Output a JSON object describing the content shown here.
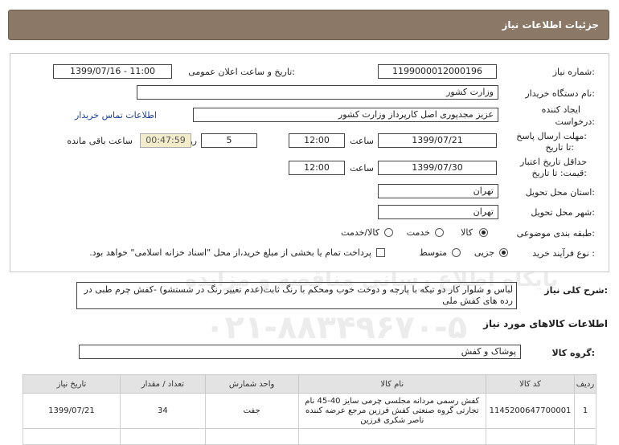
{
  "header": {
    "title": "جزئیات اطلاعات نیاز"
  },
  "form": {
    "need_number_label": "شماره نیاز:",
    "need_number": "1199000012000196",
    "announce_label": "تاریخ و ساعت اعلان عمومی:",
    "announce_value": "1399/07/16 - 11:00",
    "buyer_label": "نام دستگاه خریدار:",
    "buyer_value": "وزارت کشور",
    "creator_label_1": "ایجاد کننده",
    "creator_label_2": "درخواست:",
    "creator_value": "عزیز مجدپوری اصل کارپرداز وزارت کشور",
    "contact_link": "اطلاعات تماس خریدار",
    "deadline_label_1": "مهلت ارسال پاسخ:",
    "deadline_label_2": "تا تاریخ:",
    "deadline_date": "1399/07/21",
    "time_label": "ساعت",
    "deadline_time": "12:00",
    "days_value": "5",
    "days_label": "روز و",
    "remaining_time": "00:47:59",
    "remaining_label": "ساعت باقی مانده",
    "validity_label_1": "حداقل تاریخ اعتبار",
    "validity_label_2": "قیمت: تا تاریخ:",
    "validity_date": "1399/07/30",
    "validity_time": "12:00",
    "province_label": "استان محل تحویل:",
    "province_value": "تهران",
    "city_label": "شهر محل تحویل:",
    "city_value": "تهران",
    "category_label": "طبقه بندی موضوعی:",
    "category_options": [
      "کالا",
      "خدمت",
      "کالا/خدمت"
    ],
    "category_selected": "کالا",
    "process_label": "نوع فرآیند خرید :",
    "process_options": [
      "جزیی",
      "متوسط"
    ],
    "process_selected": "جزیی",
    "payment_note": "پرداخت تمام یا بخشی از مبلغ خرید،از محل \"اسناد خزانه اسلامی\" خواهد بود."
  },
  "description": {
    "label": "شرح کلی نیاز:",
    "text": "لباس و شلوار کار دو تیکه با پارچه  و دوخت خوب ومحکم با رنگ ثابت(عدم تغییر رنگ در شستشو)  -کفش چرم طبی در رده های کفش ملی"
  },
  "goods": {
    "section_title": "اطلاعات کالاهای مورد نیاز",
    "group_label": "گروه کالا:",
    "group_value": "پوشاک و کفش"
  },
  "table": {
    "headers": [
      "ردیف",
      "کد کالا",
      "نام کالا",
      "واحد شمارش",
      "تعداد / مقدار",
      "تاریخ نیاز"
    ],
    "rows": [
      {
        "row": "1",
        "code": "1145200647700001",
        "name": "کفش رسمی مردانه مجلسی چرمی سایز 40-45 نام تجارتی گروه صنعتی کفش فرزین مرجع عرضه کننده ناصر شکری فرزین",
        "unit": "جفت",
        "qty": "34",
        "date": "1399/07/21"
      }
    ]
  },
  "watermark": {
    "line1": "ParsNamadData",
    "line2": "پایگاه اطلاع رسانی مناقصه و مزایده",
    "line3": "۰۲۱-۸۸۳۴۹۶۷۰-۵"
  }
}
